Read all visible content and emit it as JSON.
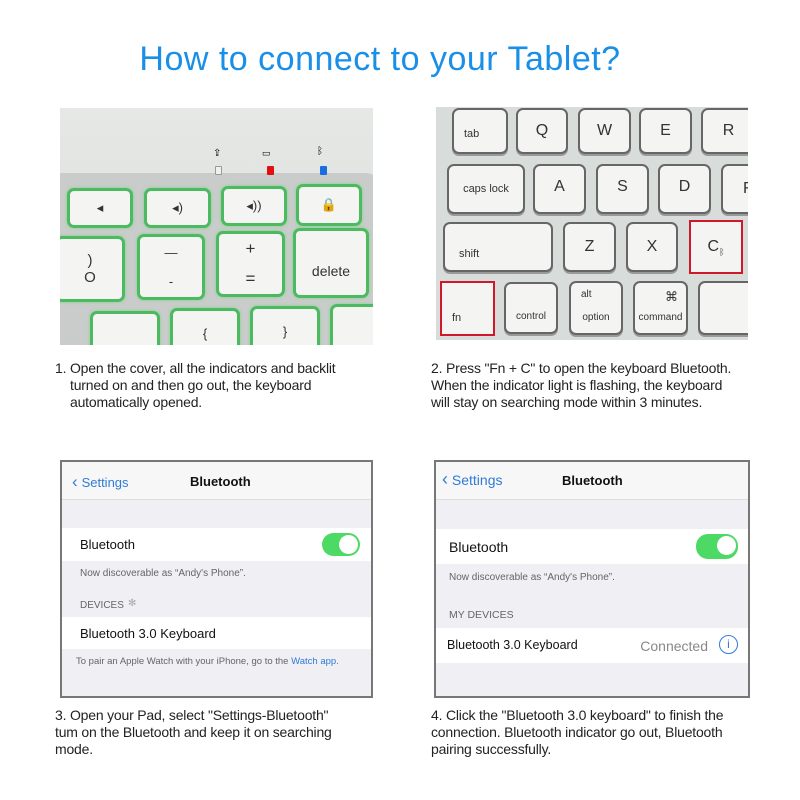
{
  "title": "How to connect to your Tablet?",
  "keyboard1": {
    "keys": {
      "delete": "delete",
      "plus": "+",
      "equals": "=",
      "underscore": "—",
      "minus": "-",
      "paren": ")",
      "zero": "O",
      "brace_open": "{",
      "brace_close": "}"
    },
    "indicators": {
      "caps": "#f0f0f0",
      "battery": "#e01010",
      "bluetooth": "#1a6fe0"
    }
  },
  "keyboard2": {
    "keys": {
      "tab": "tab",
      "q": "Q",
      "w": "W",
      "e": "E",
      "r": "R",
      "caps": "caps lock",
      "a": "A",
      "s": "S",
      "d": "D",
      "f": "F",
      "shift": "shift",
      "z": "Z",
      "x": "X",
      "c": "C",
      "fn": "fn",
      "control": "control",
      "alt": "alt",
      "option": "option",
      "cmd_symbol": "⌘",
      "command": "command"
    },
    "highlight_color": "#d0182a"
  },
  "steps": [
    {
      "lines": [
        "1. Open the cover, all the indicators and backlit",
        "turned on and then go out, the keyboard",
        "automatically opened."
      ]
    },
    {
      "lines": [
        "2. Press \"Fn + C\" to open the keyboard Bluetooth.",
        "When the indicator light is flashing, the keyboard",
        "will stay on searching mode within 3 minutes."
      ]
    },
    {
      "lines": [
        "3. Open your  Pad, select \"Settings-Bluetooth\"",
        "tum on the Bluetooth and keep it on searching",
        "mode."
      ]
    },
    {
      "lines": [
        "4. Click the \"Bluetooth 3.0 keyboard\" to finish the",
        "connection. Bluetooth indicator go out, Bluetooth",
        "pairing successfully."
      ]
    }
  ],
  "settings1": {
    "back": "Settings",
    "title": "Bluetooth",
    "bluetooth_label": "Bluetooth",
    "bluetooth_on": true,
    "discoverable": "Now discoverable as  “Andy's  Phone”.",
    "section": "DEVICES",
    "device": "Bluetooth 3.0 Keyboard",
    "footer": "To pair an Apple Watch with your iPhone, go to the ",
    "footer_link": "Watch app."
  },
  "settings2": {
    "back": "Settings",
    "title": "Bluetooth",
    "bluetooth_label": "Bluetooth",
    "bluetooth_on": true,
    "discoverable": "Now discoverable as  “Andy's  Phone”.",
    "section": "MY DEVICES",
    "device": "Bluetooth 3.0 Keyboard",
    "status": "Connected"
  },
  "colors": {
    "title": "#1a8fe8",
    "ios_blue": "#2f7bd6",
    "toggle_green": "#4cd964",
    "backlight_green": "#4dba62"
  }
}
